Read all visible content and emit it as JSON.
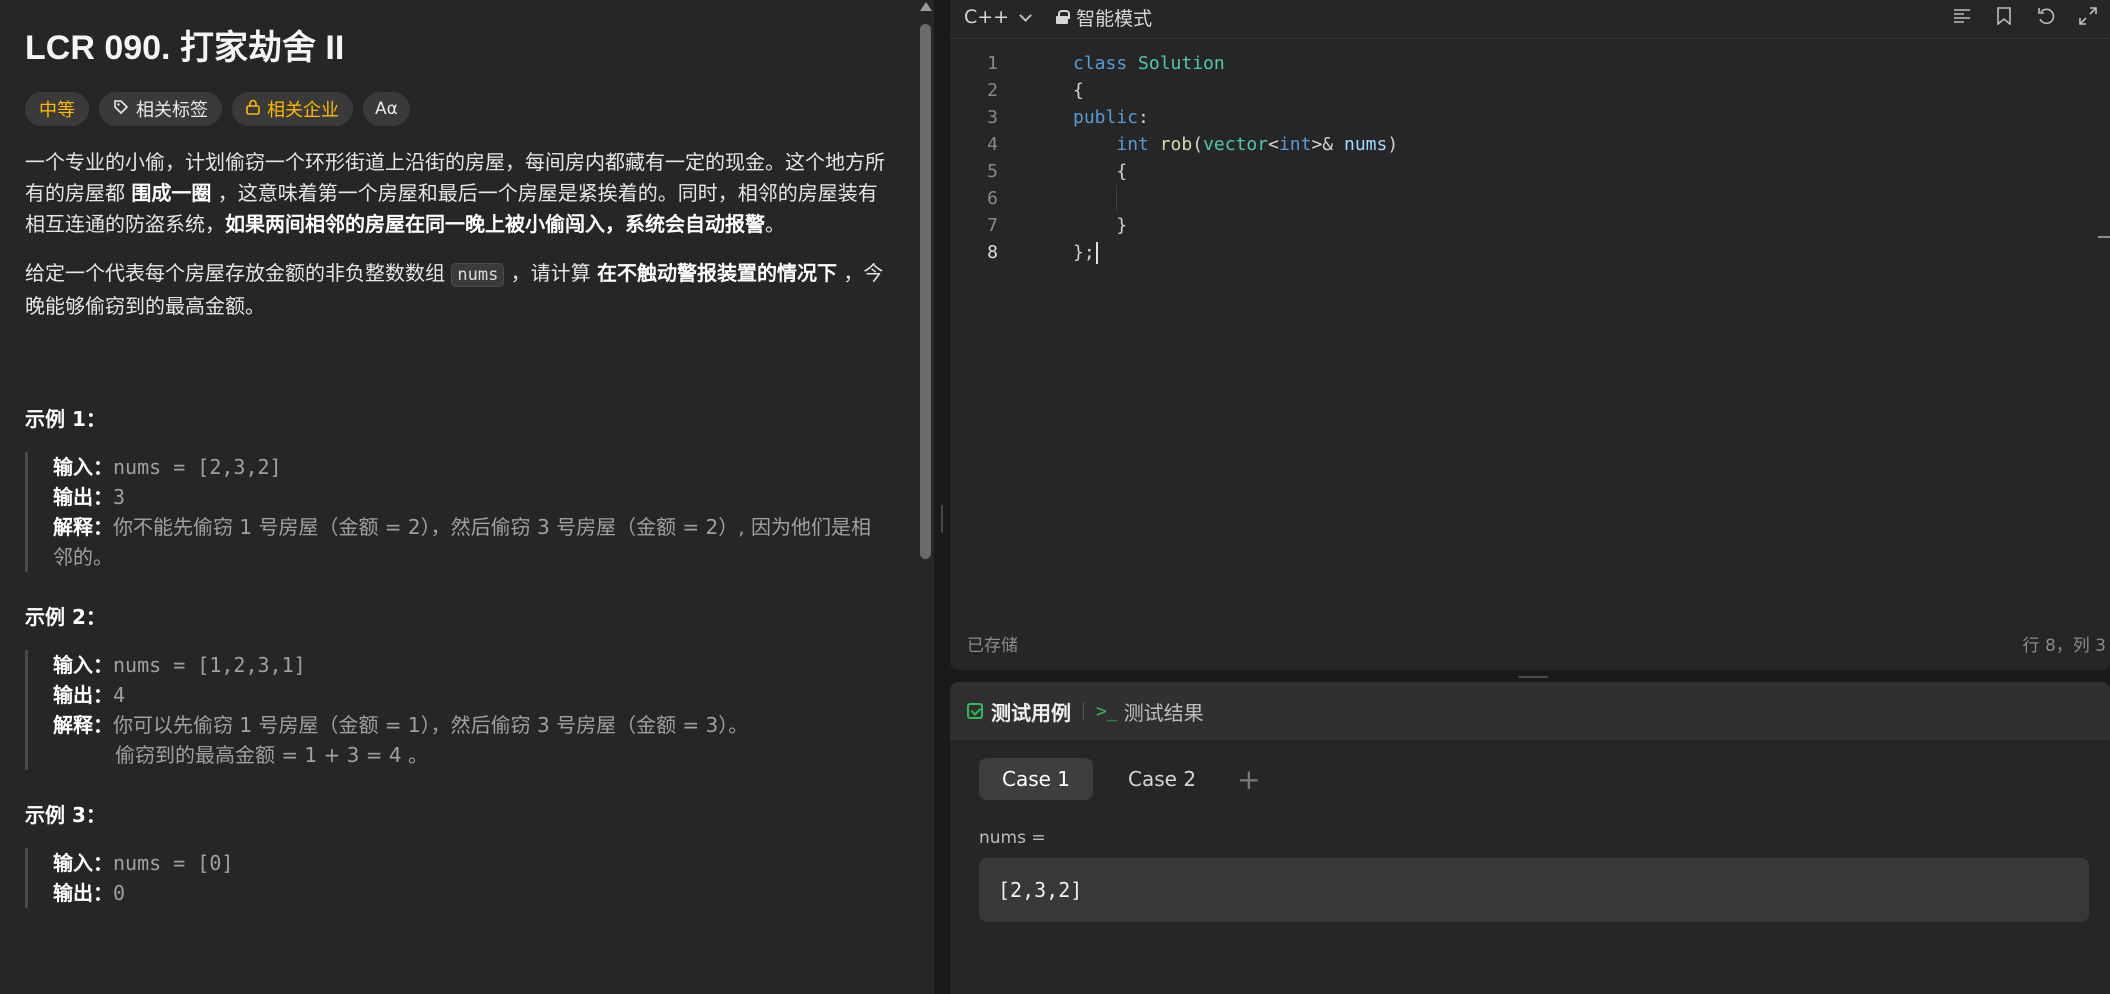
{
  "problem": {
    "title": "LCR 090. 打家劫舍 II",
    "tags": {
      "difficulty": "中等",
      "related_tags": "相关标签",
      "related_companies": "相关企业",
      "translate": "Aα"
    },
    "para1": {
      "t1": "一个专业的小偷，计划偷窃一个环形街道上沿街的房屋，每间房内都藏有一定的现金。这个地方所有的房屋都 ",
      "b1": "围成一圈",
      "t2": " ，这意味着第一个房屋和最后一个房屋是紧挨着的。同时，相邻的房屋装有相互连通的防盗系统，",
      "b2": "如果两间相邻的房屋在同一晚上被小偷闯入，系统会自动报警",
      "t3": "。"
    },
    "para2": {
      "t1": "给定一个代表每个房屋存放金额的非负整数数组 ",
      "code": "nums",
      "t2": " ，请计算 ",
      "b1": "在不触动警报装置的情况下",
      "t3": " ，今晚能够偷窃到的最高金额。"
    },
    "examples": [
      {
        "title": "示例 1：",
        "input_label": "输入：",
        "input": "nums = [2,3,2]",
        "output_label": "输出：",
        "output": "3",
        "explain_label": "解释：",
        "explain": "你不能先偷窃 1 号房屋（金额 = 2），然后偷窃 3 号房屋（金额 = 2）, 因为他们是相邻的。"
      },
      {
        "title": "示例 2：",
        "input_label": "输入：",
        "input": "nums = [1,2,3,1]",
        "output_label": "输出：",
        "output": "4",
        "explain_label": "解释：",
        "explain": "你可以先偷窃 1 号房屋（金额 = 1），然后偷窃 3 号房屋（金额 = 3）。",
        "explain2": "偷窃到的最高金额 = 1 + 3 = 4 。"
      },
      {
        "title": "示例 3：",
        "input_label": "输入：",
        "input": "nums = [0]",
        "output_label": "输出：",
        "output": "0"
      }
    ]
  },
  "editor": {
    "language": "C++",
    "mode": "智能模式",
    "line_numbers": [
      "1",
      "2",
      "3",
      "4",
      "5",
      "6",
      "7",
      "8"
    ],
    "status_saved": "已存储",
    "status_position": "行 8，列 3",
    "icons": [
      "format-icon",
      "bookmark-icon",
      "reset-icon",
      "expand-icon"
    ]
  },
  "tests": {
    "tab_cases": "测试用例",
    "tab_results": "测试结果",
    "cases": [
      "Case 1",
      "Case 2"
    ],
    "add": "+",
    "field_label": "nums =",
    "field_value": "[2,3,2]"
  },
  "colors": {
    "accent_green": "#2cbb5d",
    "difficulty": "#ffb800"
  }
}
